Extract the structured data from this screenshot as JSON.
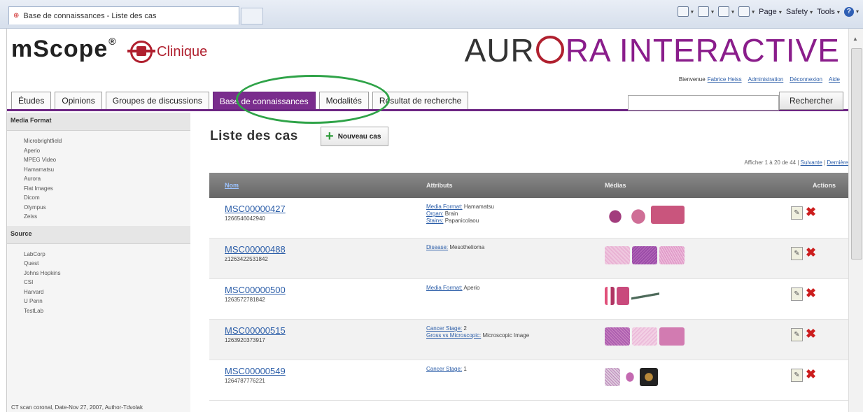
{
  "browser": {
    "tab_title": "Base de connaissances - Liste des cas",
    "cmd_page": "Page",
    "cmd_safety": "Safety",
    "cmd_tools": "Tools"
  },
  "header": {
    "logo_text": "mScope",
    "logo_mark": "®",
    "clinique": "Clinique",
    "brand_left": "AUR",
    "brand_right": "RA INTERACTIVE",
    "welcome": "Bienvenue",
    "user_name": "Fabrice Heiss",
    "link_admin": "Administration",
    "link_logout": "Déconnexion",
    "link_help": "Aide"
  },
  "tabs": [
    {
      "label": "Études"
    },
    {
      "label": "Opinions"
    },
    {
      "label": "Groupes de discussions"
    },
    {
      "label": "Base de connaissances"
    },
    {
      "label": "Modalités"
    },
    {
      "label": "Résultat de recherche"
    }
  ],
  "search": {
    "button": "Rechercher",
    "value": ""
  },
  "sidebar": {
    "media_title": "Media Format",
    "media_items": [
      "Microbrightfield",
      "Aperio",
      "MPEG Video",
      "Hamamatsu",
      "Aurora",
      "Flat Images",
      "Dicom",
      "Olympus",
      "Zeiss"
    ],
    "source_title": "Source",
    "source_items": [
      "LabCorp",
      "Quest",
      "Johns Hopkins",
      "CSI",
      "Harvard",
      "U Penn",
      "TestLab"
    ],
    "caption": "CT scan coronal, Date-Nov 27, 2007, Author-Tdvolak"
  },
  "main": {
    "title": "Liste des cas",
    "new_case": "Nouveau cas",
    "pager_text": "Afficher 1 à 20 de 44 |",
    "pager_next": "Suivante",
    "pager_sep": " | ",
    "pager_last": "Dernière"
  },
  "table": {
    "col_name": "Nom",
    "col_attrs": "Attributs",
    "col_media": "Médias",
    "col_actions": "Actions",
    "rows": [
      {
        "id": "MSC00000427",
        "num": "1266546042940",
        "attrs": [
          [
            "Media Format:",
            "Hamamatsu"
          ],
          [
            "Organ:",
            "Brain"
          ],
          [
            "Stains:",
            "Papanicolaou"
          ]
        ]
      },
      {
        "id": "MSC00000488",
        "num": "z1263422531842",
        "attrs": [
          [
            "Disease:",
            "Mesothelioma"
          ]
        ]
      },
      {
        "id": "MSC00000500",
        "num": "1263572781842",
        "attrs": [
          [
            "Media Format:",
            "Aperio"
          ]
        ]
      },
      {
        "id": "MSC00000515",
        "num": "1263920373917",
        "attrs": [
          [
            "Cancer Stage:",
            "2"
          ],
          [
            "Gross vs Microscopic:",
            "Microscopic Image"
          ]
        ]
      },
      {
        "id": "MSC00000549",
        "num": "1264787776221",
        "attrs": [
          [
            "Cancer Stage:",
            "1"
          ]
        ]
      }
    ]
  },
  "colors": {
    "accent": "#7a2d8d",
    "brand_red": "#b0202f",
    "link": "#2b5da8",
    "highlight": "#2fa348"
  }
}
